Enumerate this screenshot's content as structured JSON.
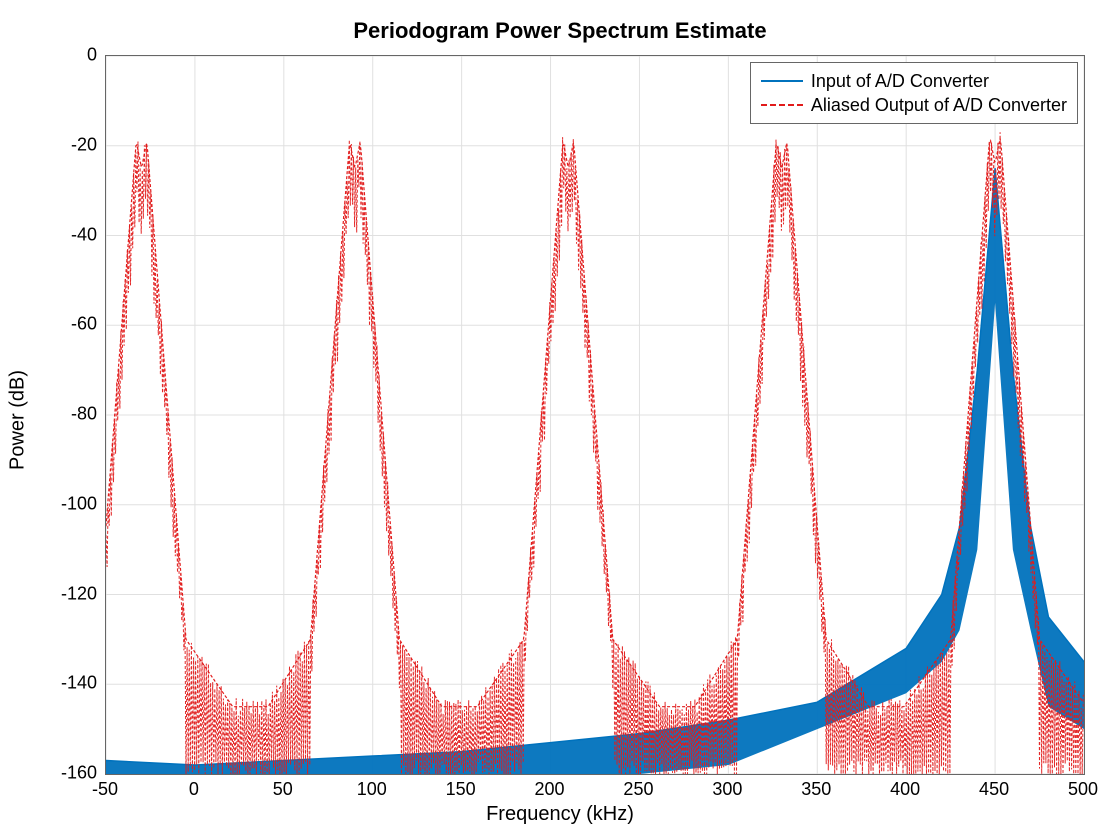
{
  "chart_data": {
    "type": "line",
    "title": "Periodogram Power Spectrum Estimate",
    "xlabel": "Frequency (kHz)",
    "ylabel": "Power (dB)",
    "xlim": [
      -50,
      500
    ],
    "ylim": [
      -160,
      0
    ],
    "xticks": [
      -50,
      0,
      50,
      100,
      150,
      200,
      250,
      300,
      350,
      400,
      450,
      500
    ],
    "yticks": [
      0,
      -20,
      -40,
      -60,
      -80,
      -100,
      -120,
      -140,
      -160
    ],
    "series": [
      {
        "name": "Input of A/D Converter",
        "color": "#0072BD",
        "style": "solid",
        "description": "Noise floor rising from about -160 dB toward the signal peak near 450 kHz",
        "x": [
          -50,
          0,
          50,
          100,
          150,
          200,
          250,
          300,
          350,
          400,
          420,
          430,
          440,
          450,
          460,
          470,
          480,
          500
        ],
        "y": [
          -157,
          -158,
          -157,
          -156,
          -155,
          -153,
          -151,
          -148,
          -144,
          -132,
          -120,
          -105,
          -70,
          -25,
          -70,
          -105,
          -125,
          -135
        ],
        "ylow": [
          -160,
          -160,
          -160,
          -160,
          -160,
          -160,
          -160,
          -158,
          -150,
          -142,
          -135,
          -128,
          -110,
          -55,
          -110,
          -128,
          -145,
          -150
        ]
      },
      {
        "name": "Aliased Output of A/D Converter",
        "color": "#E11B1B",
        "style": "dashed",
        "description": "Five aliased replicas of the signal spectrum near -30, 90, 210, 330, 450 kHz",
        "peaks": [
          {
            "center": -30,
            "peak": -25,
            "shoulder": -130,
            "floor": -150
          },
          {
            "center": 90,
            "peak": -25,
            "shoulder": -130,
            "floor": -152
          },
          {
            "center": 210,
            "peak": -25,
            "shoulder": -130,
            "floor": -150
          },
          {
            "center": 330,
            "peak": -25,
            "shoulder": -130,
            "floor": -152
          },
          {
            "center": 450,
            "peak": -24,
            "shoulder": -130,
            "floor": -150
          }
        ]
      }
    ],
    "legend": {
      "position": "upper-right-inside",
      "entries": [
        "Input of A/D Converter",
        "Aliased Output of A/D Converter"
      ]
    }
  }
}
